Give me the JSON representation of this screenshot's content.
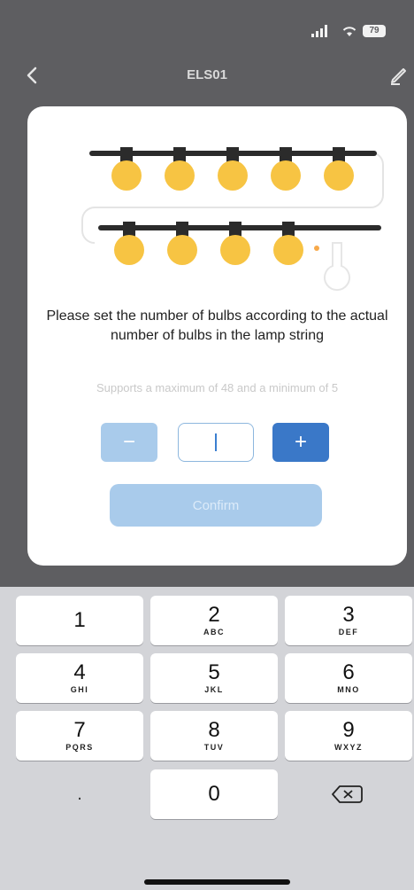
{
  "status_bar": {
    "battery_level": "79",
    "icons": [
      "signal-icon",
      "wifi-icon",
      "battery-icon"
    ]
  },
  "nav": {
    "title": "ELS01",
    "back_icon": "chevron-left-icon",
    "edit_icon": "pencil-icon"
  },
  "modal": {
    "instruction": "Please set the number of bulbs according to the actual number of bulbs in the lamp string",
    "range_hint": "Supports a maximum of 48 and a minimum of 5",
    "decrement_label": "−",
    "input_value": "",
    "increment_label": "+",
    "confirm_label": "Confirm"
  },
  "illustration": {
    "bulb_color": "#f7c443",
    "cord_color": "#2b2b2b",
    "row1_bulbs": 5,
    "row2_bulbs": 4
  },
  "keypad": {
    "keys": [
      {
        "digit": "1",
        "letters": ""
      },
      {
        "digit": "2",
        "letters": "ABC"
      },
      {
        "digit": "3",
        "letters": "DEF"
      },
      {
        "digit": "4",
        "letters": "GHI"
      },
      {
        "digit": "5",
        "letters": "JKL"
      },
      {
        "digit": "6",
        "letters": "MNO"
      },
      {
        "digit": "7",
        "letters": "PQRS"
      },
      {
        "digit": "8",
        "letters": "TUV"
      },
      {
        "digit": "9",
        "letters": "WXYZ"
      }
    ],
    "dot": ".",
    "zero": "0",
    "delete_icon": "backspace-icon"
  },
  "colors": {
    "primary": "#3a78c8",
    "primary_disabled": "#a9cbeb"
  }
}
